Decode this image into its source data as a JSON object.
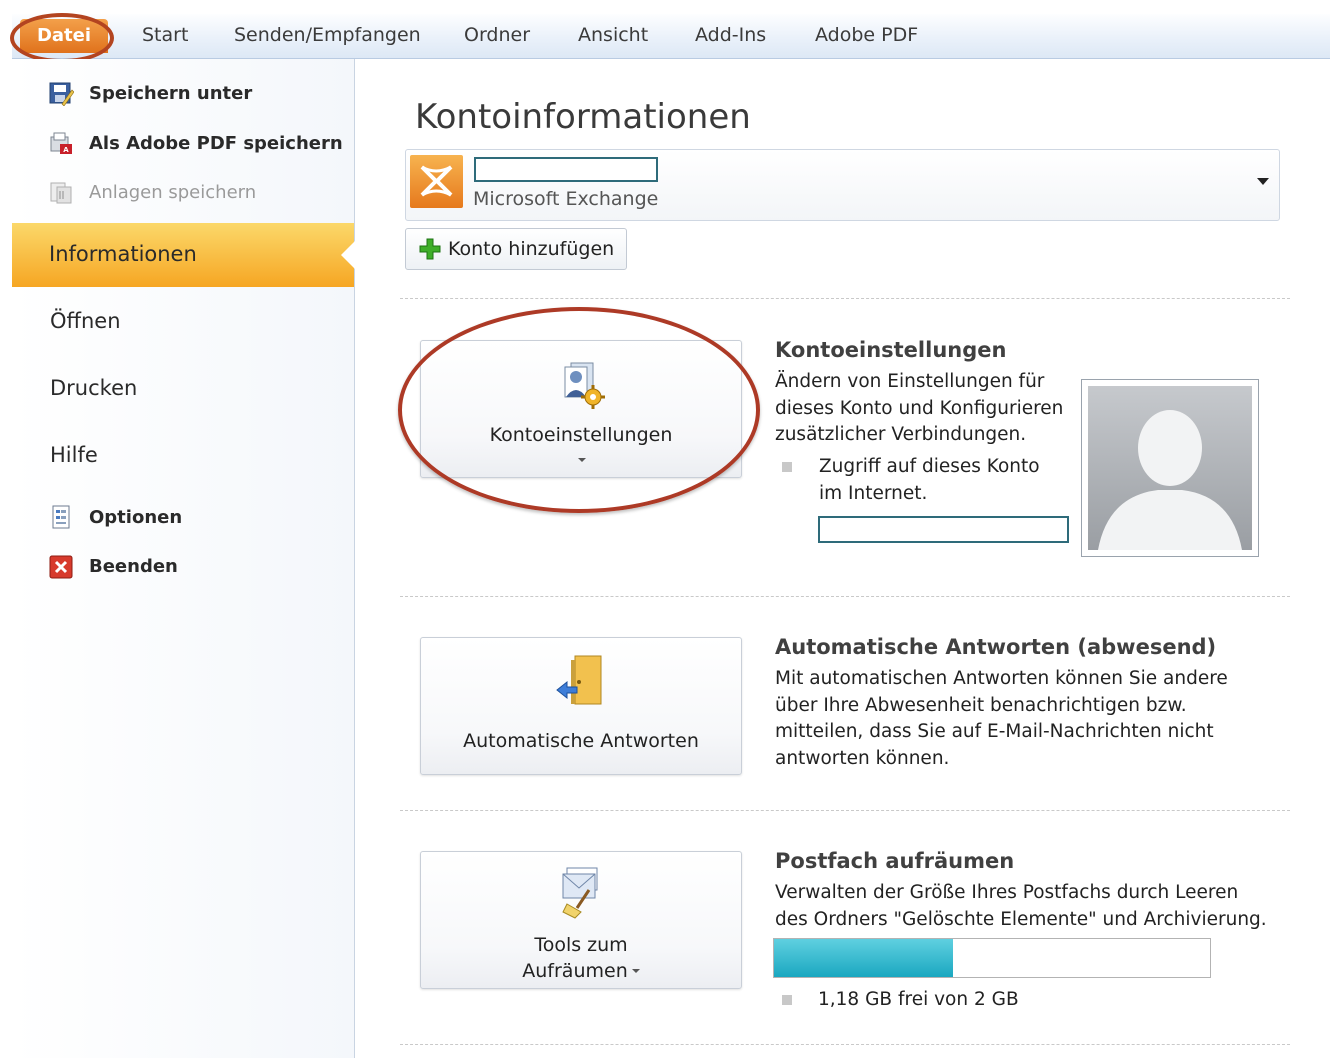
{
  "ribbon": {
    "file_tab": "Datei",
    "tabs": [
      "Start",
      "Senden/Empfangen",
      "Ordner",
      "Ansicht",
      "Add-Ins",
      "Adobe PDF"
    ]
  },
  "backstage_nav": {
    "commands_top": [
      {
        "label": "Speichern unter",
        "icon": "save-as-icon",
        "enabled": true
      },
      {
        "label": "Als Adobe PDF speichern",
        "icon": "adobe-pdf-icon",
        "enabled": true
      },
      {
        "label": "Anlagen speichern",
        "icon": "attachments-icon",
        "enabled": false
      }
    ],
    "selected_tab": "Informationen",
    "tabs": [
      "Öffnen",
      "Drucken",
      "Hilfe"
    ],
    "commands_bottom": [
      {
        "label": "Optionen",
        "icon": "options-icon"
      },
      {
        "label": "Beenden",
        "icon": "exit-icon"
      }
    ]
  },
  "main": {
    "title": "Kontoinformationen",
    "account": {
      "name": "",
      "type": "Microsoft Exchange"
    },
    "add_account_label": "Konto hinzufügen",
    "account_settings": {
      "button_label": "Kontoeinstellungen",
      "title": "Kontoeinstellungen",
      "description_lines": [
        "Ändern von Einstellungen für",
        "dieses Konto und Konfigurieren",
        "zusätzlicher Verbindungen."
      ],
      "bullet_lines": [
        "Zugriff auf dieses Konto",
        "im Internet."
      ],
      "internet_link": ""
    },
    "auto_replies": {
      "button_label": "Automatische Antworten",
      "title": "Automatische Antworten (abwesend)",
      "description_lines": [
        "Mit automatischen Antworten können Sie andere",
        "über Ihre Abwesenheit benachrichtigen bzw.",
        "mitteilen, dass Sie auf E-Mail-Nachrichten nicht",
        "antworten können."
      ]
    },
    "cleanup": {
      "button_label_lines": [
        "Tools zum",
        "Aufräumen"
      ],
      "title": "Postfach aufräumen",
      "description_lines": [
        "Verwalten der Größe Ihres Postfachs durch Leeren",
        "des Ordners \"Gelöschte Elemente\" und Archivierung."
      ],
      "quota_used_fraction": 0.41,
      "quota_text": "1,18 GB frei von 2 GB"
    }
  },
  "colors": {
    "file_tab": "#e0721c",
    "selected_nav": "#f6a623",
    "annotation_ring": "#ad3a26",
    "quota_fill": "#1aa7c0"
  }
}
